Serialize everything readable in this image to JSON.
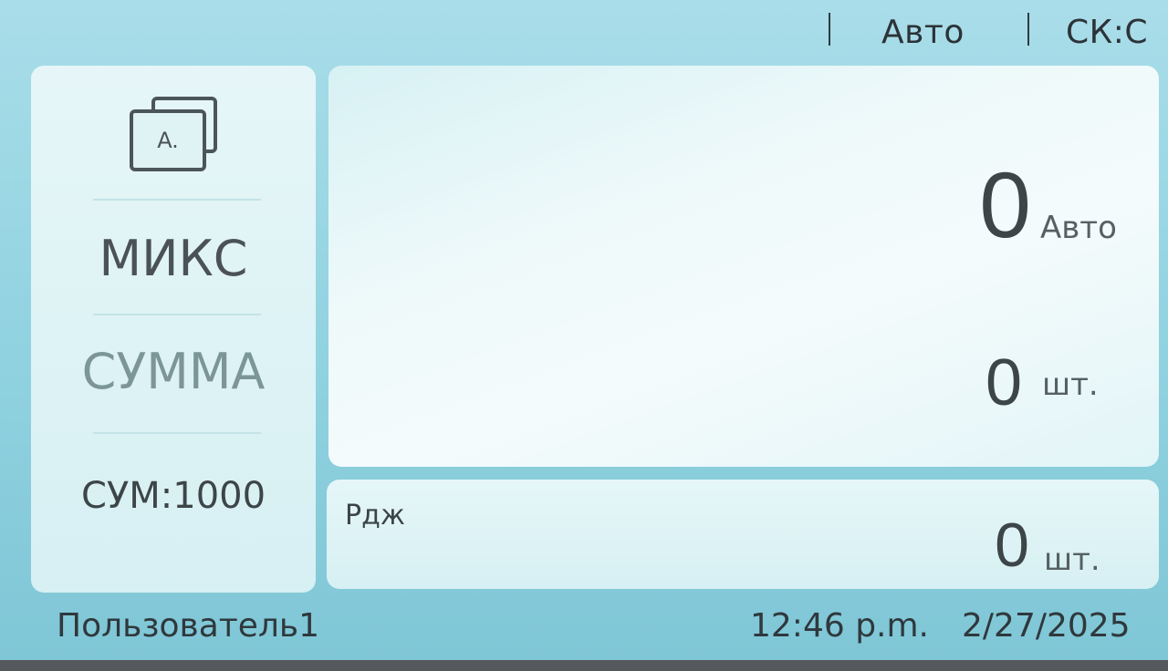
{
  "topbar": {
    "mode_text": "Авто",
    "speed_text": "СК:С"
  },
  "left_panel": {
    "icon": "banknote-stack-icon",
    "mode_label": "МИКС",
    "count_mode_label": "СУММА",
    "sum_label": "СУМ:1000"
  },
  "main_panel": {
    "denomination_value": "0",
    "denomination_unit": "Авто",
    "count_value": "0",
    "count_unit": "шт."
  },
  "reject_panel": {
    "label": "Рдж",
    "count_value": "0",
    "count_unit": "шт."
  },
  "status_bar": {
    "user": "Пользователь1",
    "time": "12:46 p.m.",
    "date": "2/27/2025"
  }
}
